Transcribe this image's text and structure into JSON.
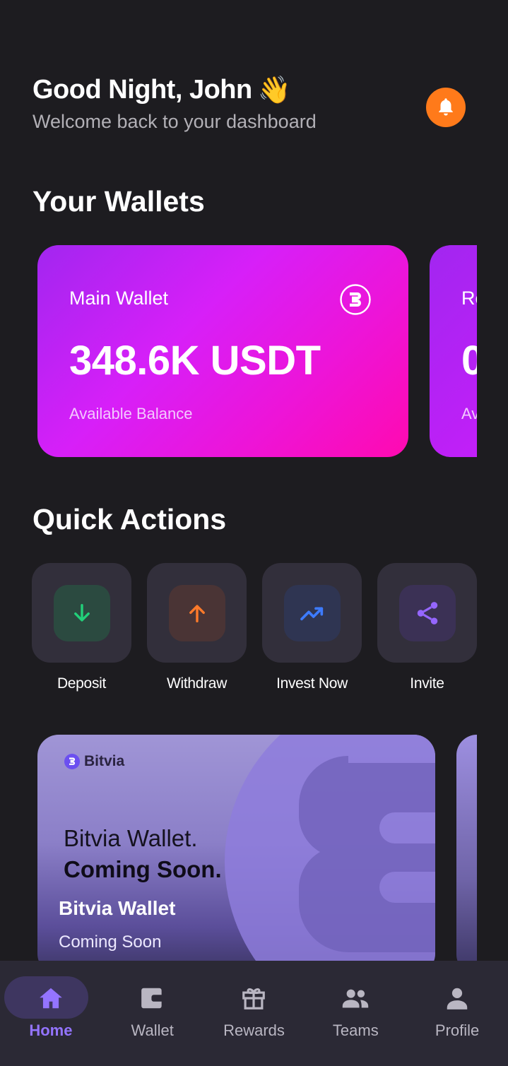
{
  "header": {
    "greeting": "Good Night, John",
    "greeting_emoji": "👋",
    "subtitle": "Welcome back to your dashboard",
    "notification_icon": "bell-icon"
  },
  "wallets": {
    "title": "Your Wallets",
    "cards": [
      {
        "name": "Main Wallet",
        "balance": "348.6K USDT",
        "caption": "Available Balance",
        "icon": "bitvia-logo-icon"
      },
      {
        "name": "Re",
        "balance": "0",
        "caption": "Av"
      }
    ]
  },
  "quick_actions": {
    "title": "Quick Actions",
    "items": [
      {
        "label": "Deposit",
        "icon": "arrow-down-icon",
        "color": "#22d07a"
      },
      {
        "label": "Withdraw",
        "icon": "arrow-up-icon",
        "color": "#ff7a2a"
      },
      {
        "label": "Invest Now",
        "icon": "trending-up-icon",
        "color": "#3d7bff"
      },
      {
        "label": "Invite",
        "icon": "share-icon",
        "color": "#9566ff"
      }
    ]
  },
  "promo": {
    "brand": "Bitvia",
    "headline_1": "Bitvia Wallet.",
    "headline_2": "Coming Soon.",
    "title": "Bitvia Wallet",
    "subtitle": "Coming Soon"
  },
  "nav": {
    "items": [
      {
        "label": "Home",
        "icon": "home-icon",
        "active": true
      },
      {
        "label": "Wallet",
        "icon": "wallet-icon",
        "active": false
      },
      {
        "label": "Rewards",
        "icon": "gift-icon",
        "active": false
      },
      {
        "label": "Teams",
        "icon": "group-icon",
        "active": false
      },
      {
        "label": "Profile",
        "icon": "person-icon",
        "active": false
      }
    ]
  },
  "colors": {
    "background": "#1d1c20",
    "accent": "#9474ff",
    "notification": "#ff7a1a",
    "wallet_gradient_start": "#a226f0",
    "wallet_gradient_end": "#ff0ab0"
  }
}
